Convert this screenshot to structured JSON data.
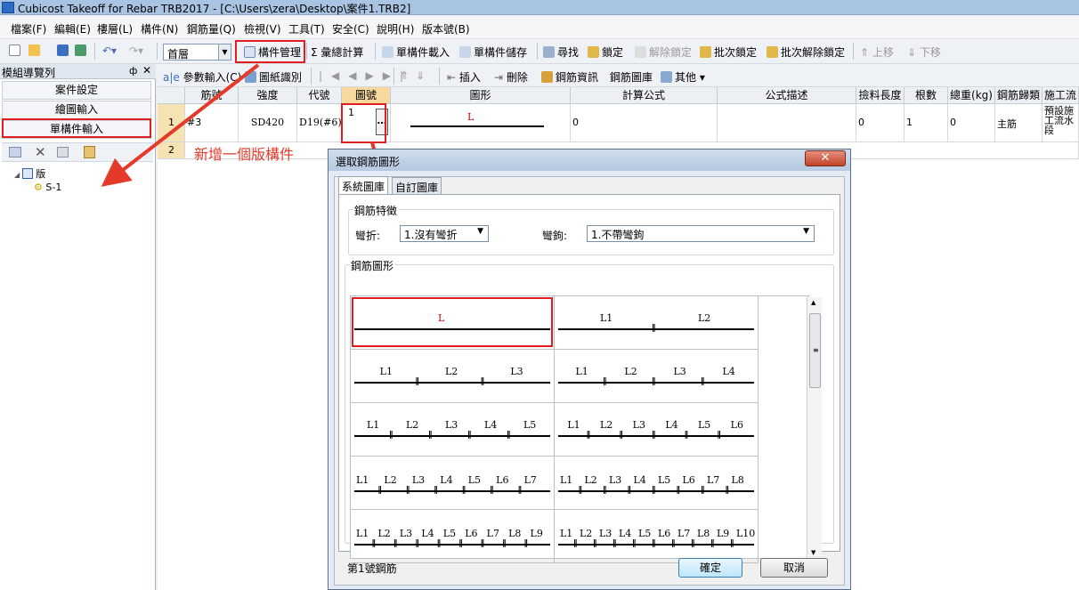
{
  "window": {
    "title": "Cubicost Takeoff for Rebar TRB2017 - [C:\\Users\\zera\\Desktop\\案件1.TRB2]"
  },
  "menu": [
    "檔案(F)",
    "編輯(E)",
    "樓層(L)",
    "構件(N)",
    "鋼筋量(Q)",
    "檢視(V)",
    "工具(T)",
    "安全(C)",
    "說明(H)",
    "版本號(B)"
  ],
  "toolbar1": {
    "floor_combo": "首層",
    "component_mgmt": "構件管理",
    "calc_total": "彙總計算",
    "single_load": "單構件載入",
    "single_save": "單構件儲存",
    "find": "尋找",
    "lock": "鎖定",
    "unlock": "解除鎖定",
    "batch_lock": "批次鎖定",
    "batch_unlock": "批次解除鎖定",
    "move_up": "上移",
    "move_down": "下移"
  },
  "toolbar2": {
    "param_input": "參數輸入(C)",
    "drawing_recog": "圖紙識別",
    "insert": "插入",
    "delete": "刪除",
    "rebar_info": "鋼筋資訊",
    "rebar_library": "鋼筋圖庫",
    "other": "其他"
  },
  "left_panel": {
    "title": "模組導覽列",
    "buttons": [
      "案件設定",
      "繪圖輸入",
      "單構件輸入"
    ],
    "tree_root": "版",
    "tree_child": "S-1"
  },
  "grid": {
    "headers": [
      "筋號",
      "強度",
      "代號",
      "圖號",
      "圖形",
      "計算公式",
      "公式描述",
      "撿料長度",
      "根數",
      "總重(kg)",
      "鋼筋歸類",
      "施工流"
    ],
    "row1": {
      "num": "1",
      "bar": "#3",
      "strength": "SD420",
      "code": "D19(#6)",
      "shape_no": "1",
      "shape_label": "L",
      "formula": "0",
      "length": "0",
      "count": "1",
      "weight": "0",
      "category": "主筋",
      "construction": "預設施工流水段"
    },
    "row2_num": "2"
  },
  "annotation": "新增一個版構件",
  "dialog": {
    "title": "選取鋼筋圖形",
    "tabs": [
      "系統圖庫",
      "自訂圖庫"
    ],
    "features_label": "鋼筋特徵",
    "bend_label": "彎折:",
    "bend_value": "1.沒有彎折",
    "hook_label": "彎鉤:",
    "hook_value": "1.不帶彎鉤",
    "shapes_label": "鋼筋圖形",
    "status_text": "第1號鋼筋",
    "ok": "確定",
    "cancel": "取消"
  },
  "shape_library": [
    {
      "labels": [
        "L"
      ]
    },
    {
      "labels": [
        "L1",
        "L2"
      ]
    },
    {
      "labels": [
        "L1",
        "L2",
        "L3"
      ]
    },
    {
      "labels": [
        "L1",
        "L2",
        "L3",
        "L4"
      ]
    },
    {
      "labels": [
        "L1",
        "L2",
        "L3",
        "L4",
        "L5"
      ]
    },
    {
      "labels": [
        "L1",
        "L2",
        "L3",
        "L4",
        "L5",
        "L6"
      ]
    },
    {
      "labels": [
        "L1",
        "L2",
        "L3",
        "L4",
        "L5",
        "L6",
        "L7"
      ]
    },
    {
      "labels": [
        "L1",
        "L2",
        "L3",
        "L4",
        "L5",
        "L6",
        "L7",
        "L8"
      ]
    },
    {
      "labels": [
        "L1",
        "L2",
        "L3",
        "L4",
        "L5",
        "L6",
        "L7",
        "L8",
        "L9"
      ]
    },
    {
      "labels": [
        "L1",
        "L2",
        "L3",
        "L4",
        "L5",
        "L6",
        "L7",
        "L8",
        "L9",
        "L10"
      ]
    }
  ],
  "colors": {
    "highlight_red": "#e02020",
    "shape_label_red": "#cc0000",
    "title_blue": "#a9c3e2"
  }
}
